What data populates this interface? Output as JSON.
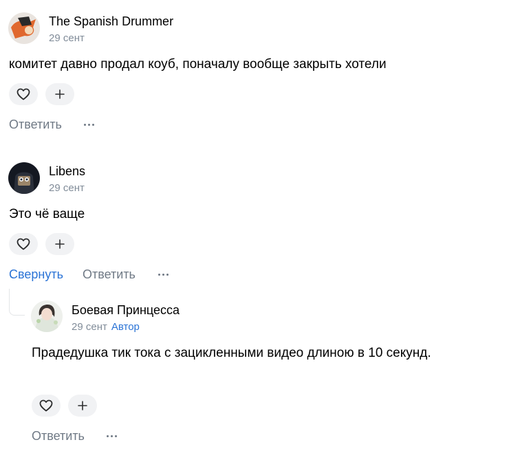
{
  "comments": [
    {
      "author": "The Spanish Drummer",
      "date": "29 сент",
      "text": "комитет давно продал коуб, поначалу вообще закрыть хотели",
      "reply_label": "Ответить"
    },
    {
      "author": "Libens",
      "date": "29 сент",
      "text": "Это чё ваще",
      "collapse_label": "Свернуть",
      "reply_label": "Ответить"
    },
    {
      "author": "Боевая Принцесса",
      "date": "29 сент",
      "badge": "Автор",
      "text": "Прадедушка тик тока с зацикленными видео длиною в 10 секунд.",
      "reply_label": "Ответить"
    }
  ],
  "icons": {
    "like": "heart-icon",
    "react": "plus-icon",
    "more": "more-dots-icon"
  },
  "colors": {
    "link_blue": "#2a73d6",
    "secondary_text": "#818c99",
    "pill_bg": "#f1f2f4"
  }
}
